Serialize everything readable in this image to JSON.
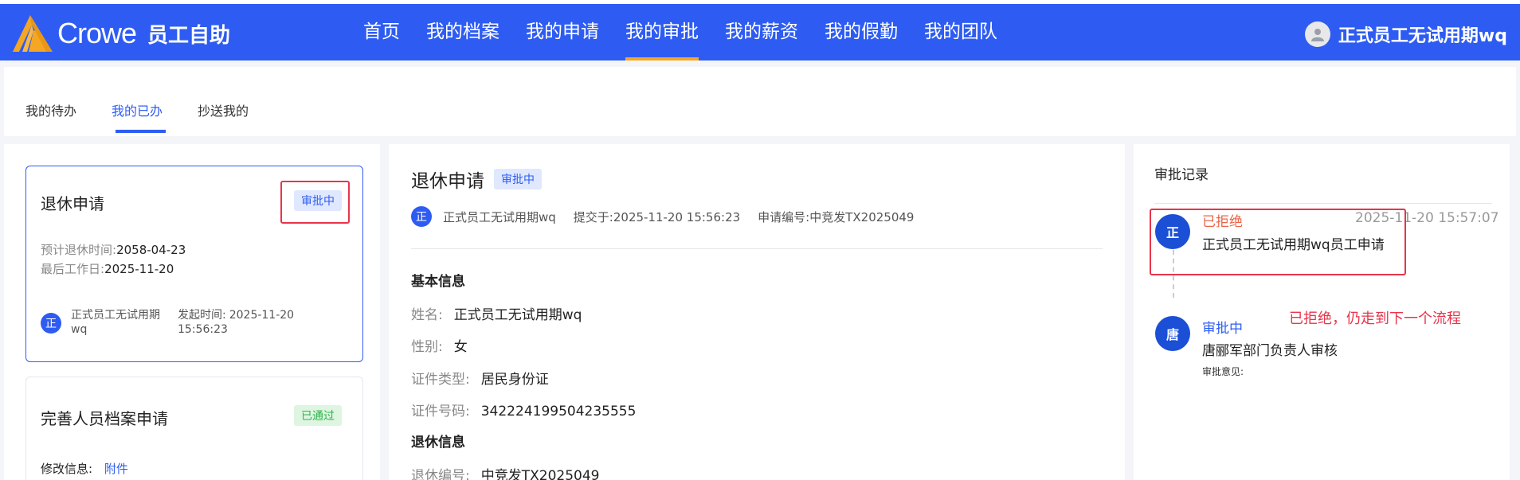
{
  "header": {
    "brand": "Crowe",
    "app_name": "员工自助",
    "nav": [
      "首页",
      "我的档案",
      "我的申请",
      "我的审批",
      "我的薪资",
      "我的假勤",
      "我的团队"
    ],
    "active_nav": "我的审批",
    "user_name": "正式员工无试用期wq"
  },
  "tabs": [
    "我的待办",
    "我的已办",
    "抄送我的"
  ],
  "active_tab": "我的已办",
  "cards": [
    {
      "title": "退休申请",
      "status": "审批中",
      "fields": [
        {
          "label": "预计退休时间:",
          "value": "2058-04-23"
        },
        {
          "label": "最后工作日:",
          "value": "2025-11-20"
        }
      ],
      "avatar": "正",
      "applicant_line1": "正式员工无试用期",
      "applicant_line2": "wq",
      "time_label": "发起时间:",
      "time_line1": "2025-11-20",
      "time_line2": "15:56:23"
    },
    {
      "title": "完善人员档案申请",
      "status": "已通过",
      "field_label": "修改信息:",
      "field_link": "附件"
    }
  ],
  "detail": {
    "title": "退休申请",
    "status": "审批中",
    "avatar": "正",
    "applicant": "正式员工无试用期wq",
    "submitted": "提交于:2025-11-20 15:56:23",
    "app_no": "申请编号:中竞发TX2025049",
    "section_basic": "基本信息",
    "basic": [
      {
        "label": "姓名:",
        "value": "正式员工无试用期wq"
      },
      {
        "label": "性别:",
        "value": "女"
      },
      {
        "label": "证件类型:",
        "value": "居民身份证"
      },
      {
        "label": "证件号码:",
        "value": "342224199504235555"
      }
    ],
    "section_retire": "退休信息",
    "retire": [
      {
        "label": "退休编号:",
        "value": "中竞发TX2025049"
      }
    ]
  },
  "records": {
    "title": "审批记录",
    "items": [
      {
        "avatar": "正",
        "status": "已拒绝",
        "time": "2025-11-20 15:57:07",
        "desc": "正式员工无试用期wq员工申请",
        "status_color": "#e8654a"
      },
      {
        "avatar": "唐",
        "status": "审批中",
        "desc": "唐郦军部门负责人审核",
        "opinion_label": "审批意见:",
        "status_color": "#2e5cf2"
      }
    ],
    "annotation": "已拒绝，仍走到下一个流程"
  },
  "colors": {
    "primary": "#2e5cf2",
    "accent": "#f5a623",
    "annotation_red": "#e8344a"
  }
}
